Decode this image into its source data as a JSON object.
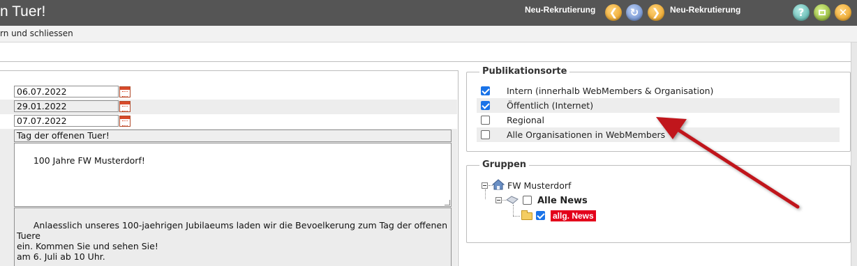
{
  "window": {
    "title": "n Tuer!",
    "nav_left_label": "Neu-Rekrutierung",
    "nav_right_label": "Neu-Rekrutierung",
    "help_symbol": "?"
  },
  "toolbar": {
    "action_label": "rn und schliessen"
  },
  "form": {
    "date_1": "06.07.2022",
    "date_2": "29.01.2022",
    "date_3": "07.07.2022",
    "title_value": "Tag der offenen Tuer!",
    "subtitle_value": "100 Jahre FW Musterdorf!",
    "body_value": "Anlaesslich unseres 100-jaehrigen Jubilaeums laden wir die Bevoelkerung zum Tag der offenen Tuere\nein. Kommen Sie und sehen Sie!\nam 6. Juli ab 10 Uhr."
  },
  "publikationsorte": {
    "legend": "Publikationsorte",
    "items": [
      {
        "label": "Intern (innerhalb WebMembers & Organisation)",
        "checked": true
      },
      {
        "label": "Öffentlich (Internet)",
        "checked": true
      },
      {
        "label": "Regional",
        "checked": false
      },
      {
        "label": "Alle Organisationen in WebMembers",
        "checked": false
      }
    ]
  },
  "gruppen": {
    "legend": "Gruppen",
    "root": "FW Musterdorf",
    "child": "Alle News",
    "leaf": "allg. News"
  },
  "colors": {
    "titlebar": "#555555",
    "highlight_badge": "#e3001b",
    "checkbox_checked": "#1a73e8",
    "annotation_arrow": "#c0141c"
  },
  "icons": [
    "arrow-left-icon",
    "refresh-icon",
    "arrow-right-icon",
    "help-icon",
    "resize-window-icon",
    "close-icon",
    "calendar-icon",
    "home-icon",
    "news-group-icon",
    "folder-icon",
    "annotation-arrow"
  ]
}
